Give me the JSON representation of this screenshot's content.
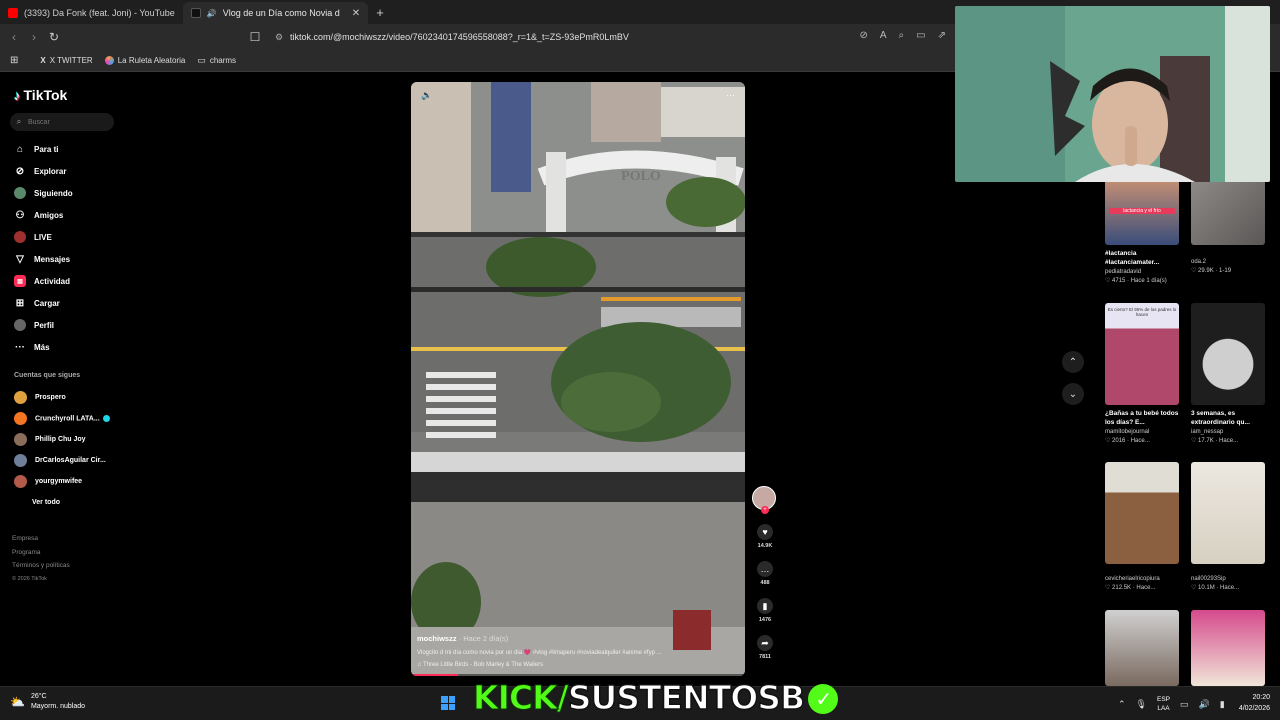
{
  "browser": {
    "tabs": [
      {
        "title": "(3393) Da Fonk (feat. Joni) - YouTube",
        "active": false
      },
      {
        "title": "Vlog de un Día como Novia d",
        "active": true
      }
    ],
    "url": "tiktok.com/@mochiwszz/video/7602340174596558088?_r=1&_t=ZS-93ePmR0LmBV",
    "bookmarks": [
      "X TWITTER",
      "La Ruleta Aleatoria",
      "charms"
    ]
  },
  "tiktok": {
    "logo": "TikTok",
    "search_placeholder": "Buscar",
    "nav": [
      {
        "label": "Para ti",
        "icon": "home-icon"
      },
      {
        "label": "Explorar",
        "icon": "compass-icon"
      },
      {
        "label": "Siguiendo",
        "icon": "following-icon"
      },
      {
        "label": "Amigos",
        "icon": "friends-icon"
      },
      {
        "label": "LIVE",
        "icon": "live-icon"
      },
      {
        "label": "Mensajes",
        "icon": "messages-icon"
      },
      {
        "label": "Actividad",
        "icon": "activity-icon"
      },
      {
        "label": "Cargar",
        "icon": "upload-icon"
      },
      {
        "label": "Perfil",
        "icon": "profile-icon"
      },
      {
        "label": "Más",
        "icon": "more-icon"
      }
    ],
    "following_header": "Cuentas que sigues",
    "following": [
      {
        "name": "Prospero",
        "color": "#e0a040"
      },
      {
        "name": "Crunchyroll LATA...",
        "color": "#f47521",
        "verified": true
      },
      {
        "name": "Phillip Chu Joy",
        "color": "#8a6d5b"
      },
      {
        "name": "DrCarlosAguilar Cir...",
        "color": "#6f7f99"
      },
      {
        "name": "yourgymwifee",
        "color": "#b45a4a"
      }
    ],
    "see_all": "Ver todo",
    "footer": [
      "Empresa",
      "Programa",
      "Términos y políticas",
      "© 2026 TikTok"
    ]
  },
  "video": {
    "username": "mochiwszz",
    "time_ago": "· Hace 2 día(s)",
    "description": "Vlogcito d mi día como novia por un dia 💗 #vlog #limaperu #noviadealquiler #anime #fyp ...",
    "music": "♫  Three Little Birds - Bob Marley & The Wailers",
    "progress": 0.14,
    "sign_text": "POLO",
    "likes": "14.9K",
    "comments": "488",
    "saves": "1476",
    "shares": "7811"
  },
  "recommended": [
    {
      "title": "#lactancia #lactanciamater...",
      "user": "pediatradavid",
      "meta": "♡ 4715 · Hace 1 día(s)",
      "thumb_text": "lactancia y el frío"
    },
    {
      "title": "",
      "user": "oda.2",
      "meta": "♡ 29.9K · 1-19",
      "thumb_text": ""
    },
    {
      "title": "¿Bañas a tu bebé todos los días? E...",
      "user": "mamitobejournal",
      "meta": "♡ 2016 · Hace...",
      "thumb_text": "Es cierto? El 95% de los padres lo hacen"
    },
    {
      "title": "3 semanas, es extraordinario qu...",
      "user": "iam_nessap",
      "meta": "♡ 17.7K · Hace...",
      "thumb_text": ""
    },
    {
      "title": "",
      "user": "cevicheriaelricopiura",
      "meta": "♡ 212.5K · Hace...",
      "thumb_text": ""
    },
    {
      "title": "",
      "user": "nail00293Sip",
      "meta": "♡ 10.1M · Hace...",
      "thumb_text": ""
    },
    {
      "title": "",
      "user": "",
      "meta": "",
      "thumb_text": ""
    },
    {
      "title": "",
      "user": "",
      "meta": "",
      "thumb_text": ""
    }
  ],
  "taskbar": {
    "temperature": "26°C",
    "weather": "Mayorm. nublado",
    "overlay_kick": "KICK/",
    "overlay_name": "SUSTENTOSB",
    "lang1": "ESP",
    "lang2": "LAA",
    "time": "20:20",
    "date": "4/02/2026"
  }
}
